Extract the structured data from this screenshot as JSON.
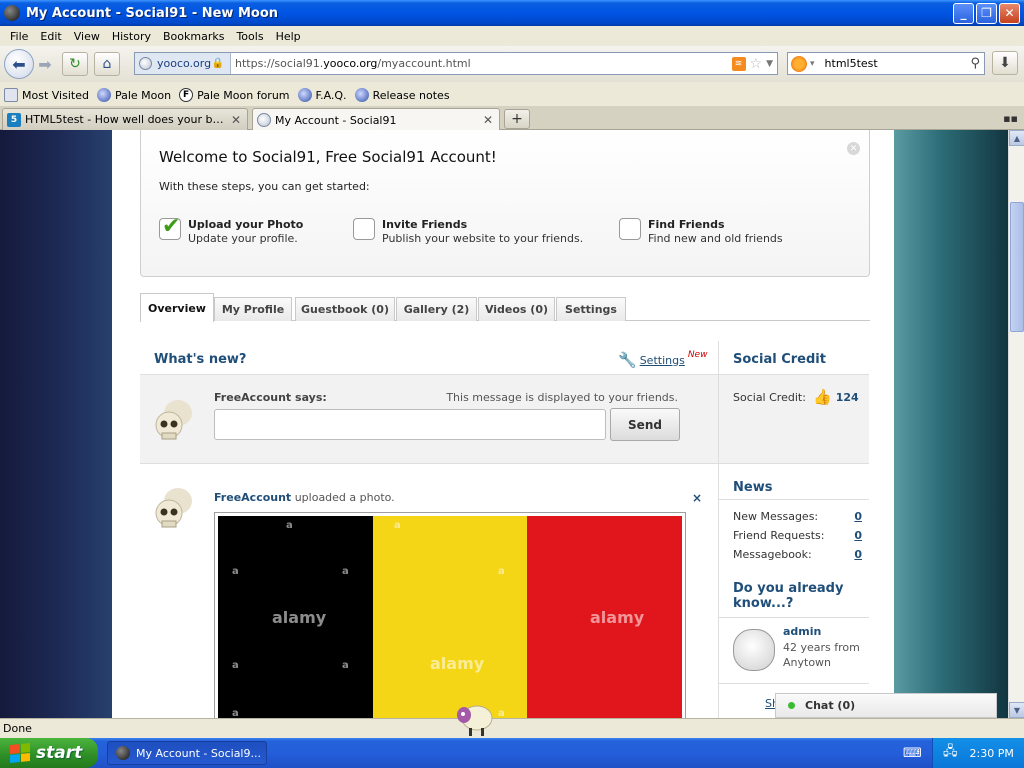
{
  "window": {
    "title": "My Account - Social91 - New Moon",
    "minimize": "_",
    "maximize": "❐",
    "close": "✕"
  },
  "menu": [
    "File",
    "Edit",
    "View",
    "History",
    "Bookmarks",
    "Tools",
    "Help"
  ],
  "nav": {
    "site_identity": "yooco.org",
    "url_prefix": "https://social91.",
    "url_domain": "yooco.org",
    "url_path": "/myaccount.html",
    "search_value": "html5test"
  },
  "bookmarks": [
    "Most Visited",
    "Pale Moon",
    "Pale Moon forum",
    "F.A.Q.",
    "Release notes"
  ],
  "tabs": [
    {
      "label": "HTML5test - How well does your browser...",
      "active": false
    },
    {
      "label": "My Account - Social91",
      "active": true
    }
  ],
  "welcome": {
    "heading": "Welcome to Social91, Free Social91 Account!",
    "intro": "With these steps, you can get started:",
    "steps": [
      {
        "title": "Upload your Photo",
        "desc": "Update your profile.",
        "checked": true
      },
      {
        "title": "Invite Friends",
        "desc": "Publish your website to your friends.",
        "checked": false
      },
      {
        "title": "Find Friends",
        "desc": "Find new and old friends",
        "checked": false
      }
    ]
  },
  "profile_tabs": [
    "Overview",
    "My Profile",
    "Guestbook (0)",
    "Gallery (2)",
    "Videos (0)",
    "Settings"
  ],
  "whats_new": {
    "title": "What's new?",
    "settings_link": "Settings",
    "new_badge": "New",
    "user_says": "FreeAccount says:",
    "note": "This message is displayed to your friends.",
    "send": "Send"
  },
  "feed": {
    "user": "FreeAccount",
    "action": " uploaded a photo.",
    "close": "×",
    "watermark_big": "alamy",
    "watermark_small": "a"
  },
  "social_credit": {
    "title": "Social Credit",
    "label": "Social Credit:",
    "value": "124"
  },
  "news": {
    "title": "News",
    "items": [
      {
        "label": "New Messages:",
        "value": "0"
      },
      {
        "label": "Friend Requests:",
        "value": "0"
      },
      {
        "label": "Messagebook:",
        "value": "0"
      }
    ]
  },
  "know": {
    "title": "Do you already know...?",
    "name": "admin",
    "line1": "42 years from",
    "line2": "Anytown",
    "sh": "Sh"
  },
  "chat": {
    "label": "Chat (0)"
  },
  "status": "Done",
  "taskbar": {
    "start": "start",
    "task": "My Account - Social9...",
    "clock": "2:30 PM"
  },
  "colors": {
    "link_blue": "#1f4e79",
    "xp_blue": "#0054e3",
    "start_green": "#2e8d25",
    "flag_black": "#000000",
    "flag_yellow": "#f4d617",
    "flag_red": "#e0161c"
  }
}
